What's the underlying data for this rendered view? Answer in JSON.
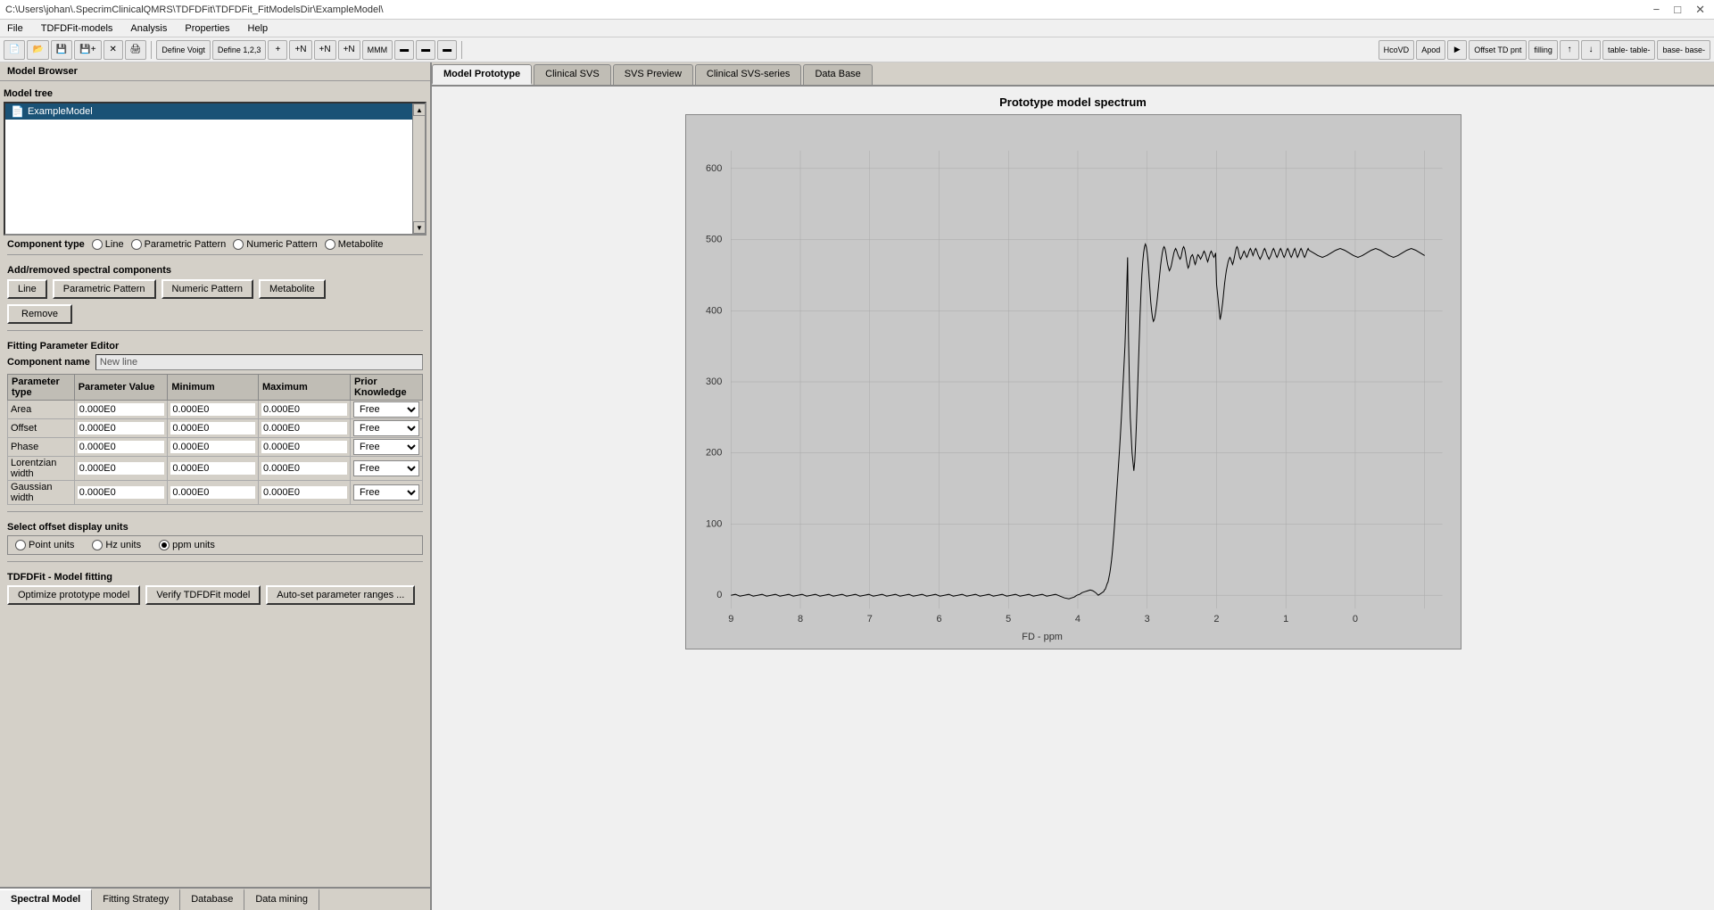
{
  "window": {
    "title": "C:\\Users\\johan\\.SpecrimClinicalQMRS\\TDFDFit\\TDFDFit_FitModelsDir\\ExampleModel\\"
  },
  "menu": {
    "items": [
      "File",
      "TDFDFit-models",
      "Analysis",
      "Properties",
      "Help"
    ]
  },
  "left_panel": {
    "title": "Model Browser",
    "model_tree": {
      "label": "Model tree",
      "item": "ExampleModel"
    },
    "component_type": {
      "label": "Component type",
      "options": [
        "Line",
        "Parametric Pattern",
        "Numeric Pattern",
        "Metabolite"
      ]
    },
    "add_remove": {
      "label": "Add/removed spectral components",
      "buttons": [
        "Line",
        "Parametric Pattern",
        "Numeric Pattern",
        "Metabolite"
      ],
      "remove_label": "Remove"
    },
    "fitting_param": {
      "label": "Fitting Parameter Editor",
      "comp_name_label": "Component name",
      "comp_name_value": "New line",
      "columns": [
        "Parameter type",
        "Parameter Value",
        "Minimum",
        "Maximum",
        "Prior Knowledge"
      ],
      "rows": [
        {
          "type": "Area",
          "value": "0.000E0",
          "min": "0.000E0",
          "max": "0.000E0",
          "prior": "Free"
        },
        {
          "type": "Offset",
          "value": "0.000E0",
          "min": "0.000E0",
          "max": "0.000E0",
          "prior": "Free"
        },
        {
          "type": "Phase",
          "value": "0.000E0",
          "min": "0.000E0",
          "max": "0.000E0",
          "prior": "Free"
        },
        {
          "type": "Lorentzian width",
          "value": "0.000E0",
          "min": "0.000E0",
          "max": "0.000E0",
          "prior": "Free"
        },
        {
          "type": "Gaussian width",
          "value": "0.000E0",
          "min": "0.000E0",
          "max": "0.000E0",
          "prior": "Free"
        }
      ]
    },
    "offset_display": {
      "label": "Select offset display units",
      "options": [
        "Point units",
        "Hz units",
        "ppm units"
      ],
      "selected": "ppm units"
    },
    "tdffit": {
      "label": "TDFDFit - Model fitting",
      "buttons": [
        "Optimize prototype model",
        "Verify TDFDFit model",
        "Auto-set parameter ranges ..."
      ]
    }
  },
  "bottom_tabs": {
    "tabs": [
      "Spectral Model",
      "Fitting Strategy",
      "Database",
      "Data mining"
    ],
    "active": "Spectral Model"
  },
  "right_panel": {
    "tabs": [
      "Model Prototype",
      "Clinical SVS",
      "SVS Preview",
      "Clinical SVS-series",
      "Data Base"
    ],
    "active_tab": "Model Prototype",
    "chart": {
      "title": "Prototype model spectrum",
      "x_label": "FD - ppm",
      "y_values": [
        0,
        100,
        200,
        300,
        400,
        500,
        600
      ],
      "x_ticks": [
        9,
        8,
        7,
        6,
        5,
        4,
        3,
        2,
        1,
        0
      ]
    }
  }
}
